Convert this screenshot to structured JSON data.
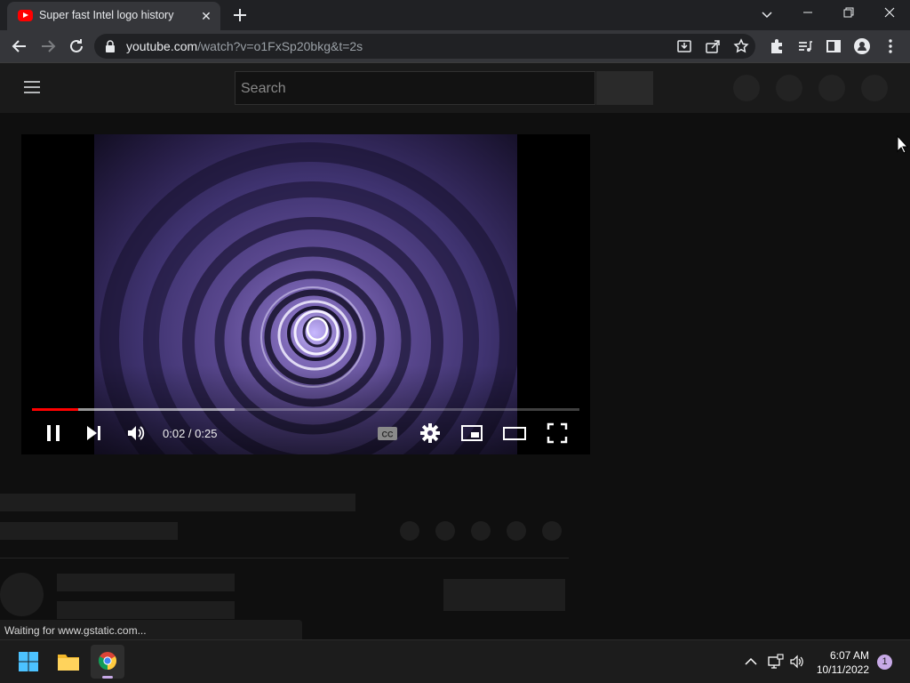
{
  "browser": {
    "tab": {
      "title": "Super fast Intel logo history",
      "close_glyph": "✕",
      "favicon": "youtube-favicon-icon"
    },
    "address_bar": {
      "host": "youtube.com",
      "path": "/watch?v=o1FxSp20bkg&t=2s"
    },
    "status_text": "Waiting for www.gstatic.com..."
  },
  "youtube": {
    "search": {
      "placeholder": "Search"
    },
    "player": {
      "current_time": "0:02",
      "duration": "0:25",
      "time_display": "0:02 / 0:25",
      "progress_played_fraction": 0.085,
      "progress_buffered_fraction": 0.37,
      "captions_label": "CC"
    }
  },
  "taskbar": {
    "time": "6:07 AM",
    "date": "10/11/2022",
    "notification_count": "1"
  },
  "colors": {
    "youtube_red": "#ff0000",
    "page_background": "#0f0f0f",
    "accent_badge": "#c7a9e6"
  }
}
